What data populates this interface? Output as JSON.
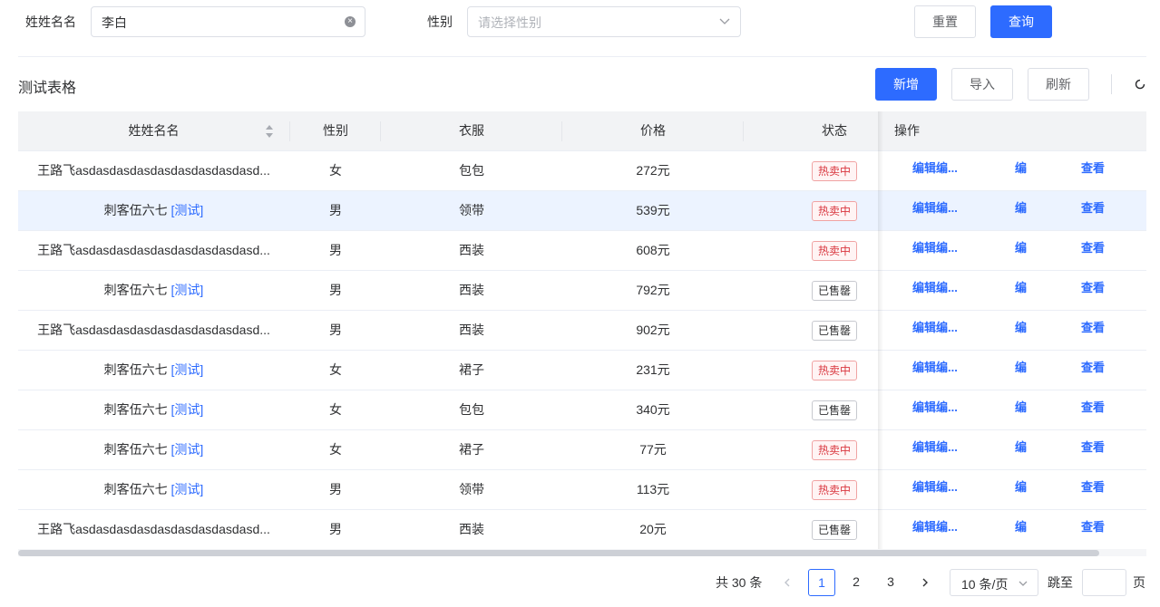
{
  "search": {
    "name_label": "姓姓名名",
    "name_value": "李白",
    "gender_label": "性别",
    "gender_placeholder": "请选择性别",
    "reset_label": "重置",
    "query_label": "查询"
  },
  "table_title": "测试表格",
  "toolbar": {
    "add_label": "新增",
    "import_label": "导入",
    "refresh_label": "刷新"
  },
  "columns": [
    "姓姓名名",
    "性别",
    "衣服",
    "价格",
    "状态",
    "操作"
  ],
  "rows": [
    {
      "name": "王路飞asdasdasdasdasdasdasdasdasd...",
      "tag": "",
      "gender": "女",
      "clothes": "包包",
      "price": "272元",
      "status": "热卖中",
      "status_type": "hot"
    },
    {
      "name": "刺客伍六七",
      "tag": "[测试]",
      "gender": "男",
      "clothes": "领带",
      "price": "539元",
      "status": "热卖中",
      "status_type": "hot"
    },
    {
      "name": "王路飞asdasdasdasdasdasdasdasdasd...",
      "tag": "",
      "gender": "男",
      "clothes": "西装",
      "price": "608元",
      "status": "热卖中",
      "status_type": "hot"
    },
    {
      "name": "刺客伍六七",
      "tag": "[测试]",
      "gender": "男",
      "clothes": "西装",
      "price": "792元",
      "status": "已售罄",
      "status_type": "sold"
    },
    {
      "name": "王路飞asdasdasdasdasdasdasdasdasd...",
      "tag": "",
      "gender": "男",
      "clothes": "西装",
      "price": "902元",
      "status": "已售罄",
      "status_type": "sold"
    },
    {
      "name": "刺客伍六七",
      "tag": "[测试]",
      "gender": "女",
      "clothes": "裙子",
      "price": "231元",
      "status": "热卖中",
      "status_type": "hot"
    },
    {
      "name": "刺客伍六七",
      "tag": "[测试]",
      "gender": "女",
      "clothes": "包包",
      "price": "340元",
      "status": "已售罄",
      "status_type": "sold"
    },
    {
      "name": "刺客伍六七",
      "tag": "[测试]",
      "gender": "女",
      "clothes": "裙子",
      "price": "77元",
      "status": "热卖中",
      "status_type": "hot"
    },
    {
      "name": "刺客伍六七",
      "tag": "[测试]",
      "gender": "男",
      "clothes": "领带",
      "price": "113元",
      "status": "热卖中",
      "status_type": "hot"
    },
    {
      "name": "王路飞asdasdasdasdasdasdasdasdasd...",
      "tag": "",
      "gender": "男",
      "clothes": "西装",
      "price": "20元",
      "status": "已售罄",
      "status_type": "sold"
    }
  ],
  "actions": {
    "edit_long": "编辑编...",
    "edit_short": "编",
    "view": "查看"
  },
  "pagination": {
    "total": "共 30 条",
    "pages": [
      "1",
      "2",
      "3"
    ],
    "current_page": "1",
    "page_size": "10 条/页",
    "jump_label": "跳至",
    "page_suffix": "页"
  }
}
